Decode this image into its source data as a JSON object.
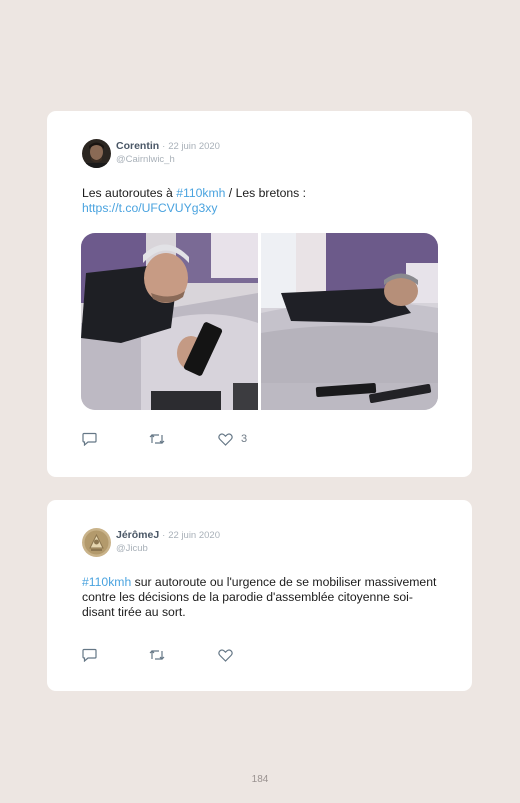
{
  "tweets": [
    {
      "author": "Corentin",
      "separator": "·",
      "date": "22 juin 2020",
      "handle": "@Cairnlwic_h",
      "text_before": "Les autoroutes à ",
      "hashtag": "#110kmh",
      "text_after": " / Les bretons :",
      "link": "https://t.co/UFCVUYg3xy",
      "likes": "3"
    },
    {
      "author": "JérômeJ",
      "separator": "·",
      "date": "22 juin 2020",
      "handle": "@Jicub",
      "hashtag": "#110kmh",
      "text_after": " sur autoroute ou l'urgence de se mobiliser massivement contre les décisions de la parodie d'assemblée citoyenne soi-disant tirée au sort."
    }
  ],
  "page_number": "184"
}
